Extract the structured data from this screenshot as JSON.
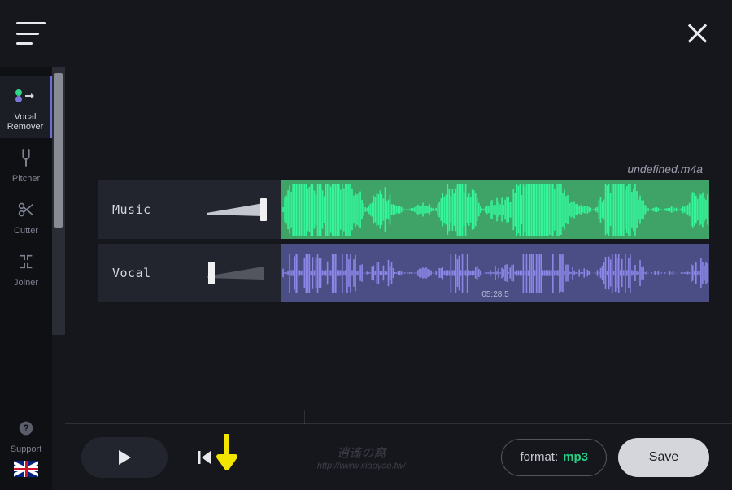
{
  "sidebar": {
    "items": [
      {
        "label": "Vocal Remover"
      },
      {
        "label": "Pitcher"
      },
      {
        "label": "Cutter"
      },
      {
        "label": "Joiner"
      }
    ],
    "support_label": "Support"
  },
  "file": {
    "name": "undefined.m4a"
  },
  "tracks": {
    "music": {
      "label": "Music",
      "volume": 1.0
    },
    "vocal": {
      "label": "Vocal",
      "volume": 0.08,
      "time_marker": "05:28.5"
    }
  },
  "controls": {
    "format_label": "format:",
    "format_value": "mp3",
    "save_label": "Save"
  },
  "colors": {
    "music_wave": "#35f59b",
    "vocal_wave": "#8b86e8",
    "accent_arrow": "#f2e600"
  },
  "watermark": {
    "line1": "逍遙の窩",
    "line2": "http://www.xiaoyao.tw/"
  }
}
